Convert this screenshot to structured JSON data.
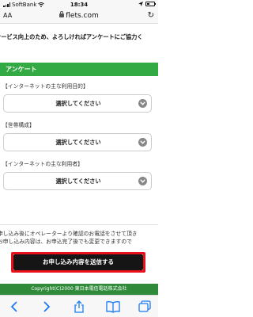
{
  "status_bar": {
    "carrier": "SoftBank",
    "time": "18:34",
    "battery_level": 0.35
  },
  "browser": {
    "aa_label": "AA",
    "url": "flets.com"
  },
  "notice": "サービス向上のため、よろしければアンケートにご協力く",
  "survey": {
    "header": "アンケート",
    "fields": [
      {
        "label": "【インターネットの主な利用目的】",
        "value": "選択してください"
      },
      {
        "label": "【世帯構成】",
        "value": "選択してください"
      },
      {
        "label": "【インターネットの主な利用者】",
        "value": "選択してください"
      }
    ]
  },
  "notes": [
    "申し込み後にオペレーターより確認のお電話をさせて頂き",
    "お申し込み内容は、お申込完了後でも変更できますので",
    "お申し込みに進んでください。"
  ],
  "submit_label": "お申し込み内容を送信する",
  "footer": "Copyright(C)2000 東日本電信電話株式会社",
  "icons": {
    "lock": "lock-icon",
    "reload": "reload-icon",
    "back": "back-arrow-icon",
    "forward": "forward-arrow-icon",
    "share": "share-icon",
    "bookmarks": "bookmarks-icon",
    "tabs": "tabs-icon"
  },
  "colors": {
    "survey_header": "#33aa44",
    "footer": "#2f8a3a",
    "submit_button": "#151515",
    "highlight": "#e8101a",
    "ios_blue": "#1a7cf4"
  }
}
